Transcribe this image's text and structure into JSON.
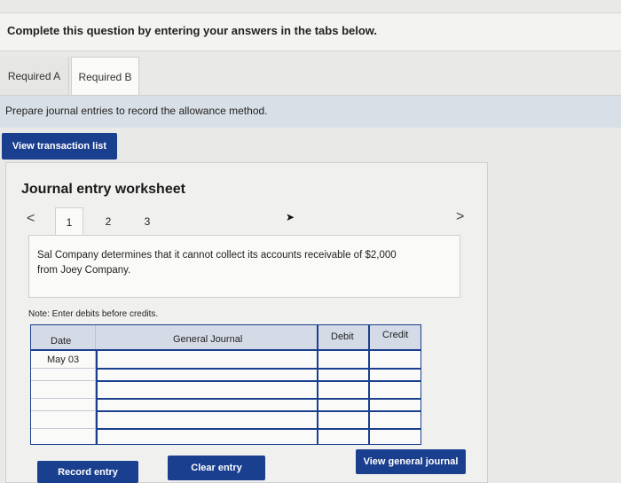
{
  "banner": {
    "text": "Complete this question by entering your answers in the tabs below."
  },
  "tabs": [
    {
      "label": "Required A"
    },
    {
      "label": "Required B"
    }
  ],
  "instruction": "Prepare journal entries to record the allowance method.",
  "buttons": {
    "view_transaction_list": "View transaction list",
    "record_entry": "Record entry",
    "clear_entry": "Clear entry",
    "view_general_journal": "View general journal"
  },
  "worksheet": {
    "title": "Journal entry worksheet",
    "steps": [
      "1",
      "2",
      "3"
    ],
    "prev_glyph": "<",
    "next_glyph": ">",
    "description": "Sal Company determines that it cannot collect its accounts receivable of $2,000 from Joey Company.",
    "note": "Note: Enter debits before credits."
  },
  "journal_table": {
    "headers": {
      "date": "Date",
      "account": "General Journal",
      "debit": "Debit",
      "credit": "Credit"
    },
    "rows": [
      {
        "date": "May 03",
        "account": "",
        "debit": "",
        "credit": ""
      },
      {
        "date": "",
        "account": "",
        "debit": "",
        "credit": ""
      },
      {
        "date": "",
        "account": "",
        "debit": "",
        "credit": ""
      },
      {
        "date": "",
        "account": "",
        "debit": "",
        "credit": ""
      },
      {
        "date": "",
        "account": "",
        "debit": "",
        "credit": ""
      },
      {
        "date": "",
        "account": "",
        "debit": "",
        "credit": ""
      }
    ]
  },
  "colors": {
    "primary_button": "#1b3f8f",
    "instruction_bg": "#d9dfe6",
    "table_header_bg": "#d5dbe6"
  }
}
